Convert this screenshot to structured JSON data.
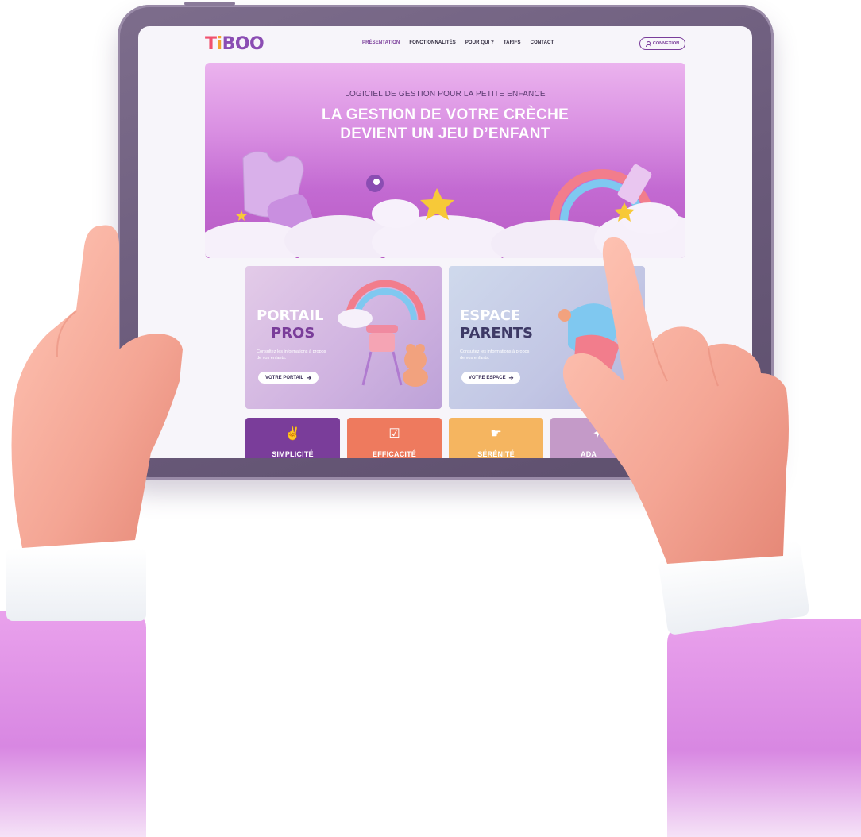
{
  "brand": {
    "logo_letters": [
      "T",
      "i",
      "B",
      "O",
      "O"
    ]
  },
  "nav": {
    "items": [
      "PRÉSENTATION",
      "FONCTIONNALITÉS",
      "POUR QUI ?",
      "TARIFS",
      "CONTACT"
    ],
    "active": "PRÉSENTATION",
    "login_label": "CONNEXION"
  },
  "hero": {
    "subtitle": "LOGICIEL DE GESTION POUR LA PETITE ENFANCE",
    "title_line1": "LA GESTION DE VOTRE CRÈCHE",
    "title_line2": "DEVIENT UN JEU D’ENFANT"
  },
  "cards": {
    "pros": {
      "line1": "PORTAIL",
      "line2": "PROS",
      "desc": "Consultez les informations à propos de vos enfants.",
      "button": "VOTRE PORTAIL"
    },
    "parents": {
      "line1": "ESPACE",
      "line2": "PARENTS",
      "desc": "Consultez les informations à propos de vos enfants.",
      "button": "VOTRE ESPACE"
    }
  },
  "tiles": [
    {
      "label": "SIMPLICITÉ",
      "color": "#7a3d9a",
      "icon": "hand-snap-icon"
    },
    {
      "label": "EFFICACITÉ",
      "color": "#ee7a5e",
      "icon": "check-icon"
    },
    {
      "label": "SÉRÉNITÉ",
      "color": "#f5b560",
      "icon": "ok-hand-icon"
    },
    {
      "label": "ADA",
      "color": "#c49ac8",
      "icon": "adapt-icon"
    }
  ],
  "colors": {
    "brand_purple": "#7a3d9a",
    "hero_pink": "#d98fe2",
    "tablet_frame": "#6a5a7a"
  }
}
